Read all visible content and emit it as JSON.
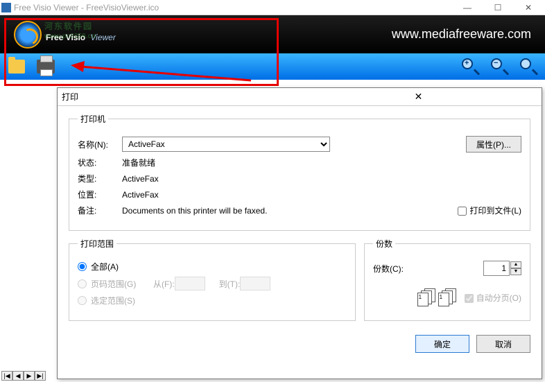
{
  "window": {
    "title": "Free Visio Viewer - FreeVisioViewer.ico",
    "app_bold": "Free Visio",
    "app_thin": "Viewer",
    "url": "www.mediafreeware.com"
  },
  "watermark": {
    "text": "河东软件园",
    "url": "www.pc0359.cn"
  },
  "toolbar": {
    "open": "open",
    "print": "print",
    "zoom_in": "+",
    "zoom_out": "−",
    "zoom_fit": " "
  },
  "nav": {
    "first": "|◀",
    "prev": "◀",
    "next": "▶",
    "last": "▶|"
  },
  "dialog": {
    "title": "打印",
    "printer_group": "打印机",
    "name_label": "名称(N):",
    "name_value": "ActiveFax",
    "properties_btn": "属性(P)...",
    "status_label": "状态:",
    "status_value": "准备就绪",
    "type_label": "类型:",
    "type_value": "ActiveFax",
    "where_label": "位置:",
    "where_value": "ActiveFax",
    "comment_label": "备注:",
    "comment_value": "Documents on this printer will be faxed.",
    "print_to_file": "打印到文件(L)",
    "range_group": "打印范围",
    "range_all": "全部(A)",
    "range_pages": "页码范围(G)",
    "from_label": "从(F):",
    "to_label": "到(T):",
    "range_selection": "选定范围(S)",
    "copies_group": "份数",
    "copies_label": "份数(C):",
    "copies_value": "1",
    "collate_label": "自动分页(O)",
    "ok": "确定",
    "cancel": "取消"
  }
}
